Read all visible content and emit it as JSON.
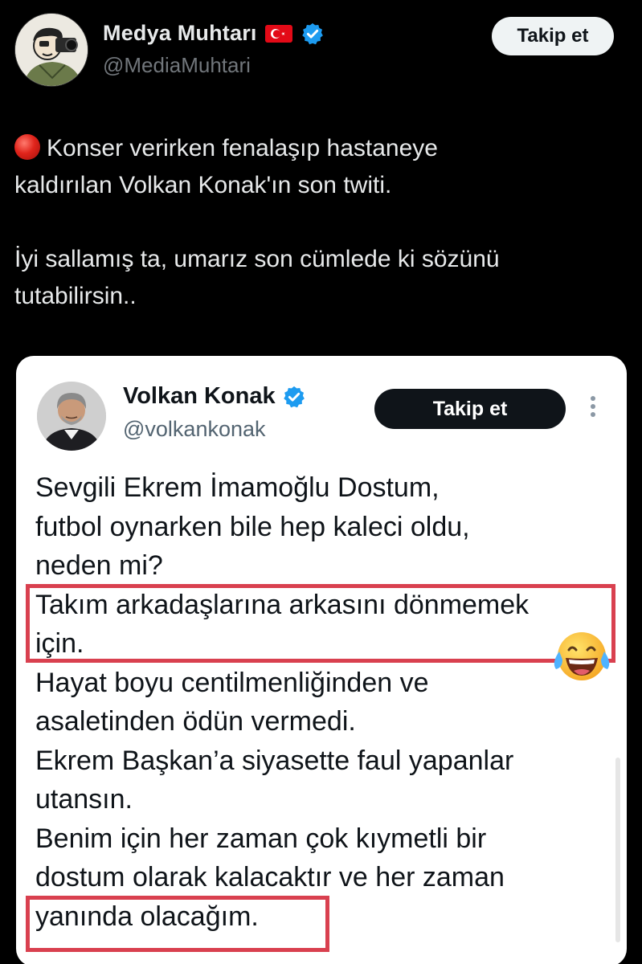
{
  "outer_tweet": {
    "display_name": "Medya Muhtarı",
    "handle": "@MediaMuhtari",
    "follow_label": "Takip et",
    "text_lines": [
      "Konser verirken fenalaşıp hastaneye",
      "kaldırılan Volkan Konak'ın son twiti.",
      "İyi sallamış ta, umarız son cümlede ki sözünü",
      "tutabilirsin.."
    ],
    "icons": [
      "avatar",
      "turkish-flag-icon",
      "verified-badge-icon",
      "red-circle-icon"
    ]
  },
  "embedded_tweet": {
    "display_name": "Volkan Konak",
    "handle": "@volkankonak",
    "follow_label": "Takip et",
    "text_lines": [
      "Sevgili Ekrem İmamoğlu Dostum,",
      "futbol oynarken bile hep kaleci oldu,",
      "neden mi?",
      "Takım arkadaşlarına arkasını dönmemek",
      "için.",
      "Hayat boyu centilmenliğinden ve",
      "asaletinden ödün vermedi.",
      "Ekrem Başkan’a siyasette faul yapanlar",
      "utansın.",
      "Benim için her zaman çok kıymetli bir",
      "dostum olarak kalacaktır ve her zaman",
      "yanında olacağım."
    ],
    "icons": [
      "avatar",
      "verified-badge-icon",
      "more-options-icon",
      "laughing-tears-emoji-icon"
    ]
  },
  "colors": {
    "background": "#000000",
    "verified_blue": "#1d9bf0",
    "highlight_red": "#d9404f",
    "card_background": "#ffffff"
  }
}
